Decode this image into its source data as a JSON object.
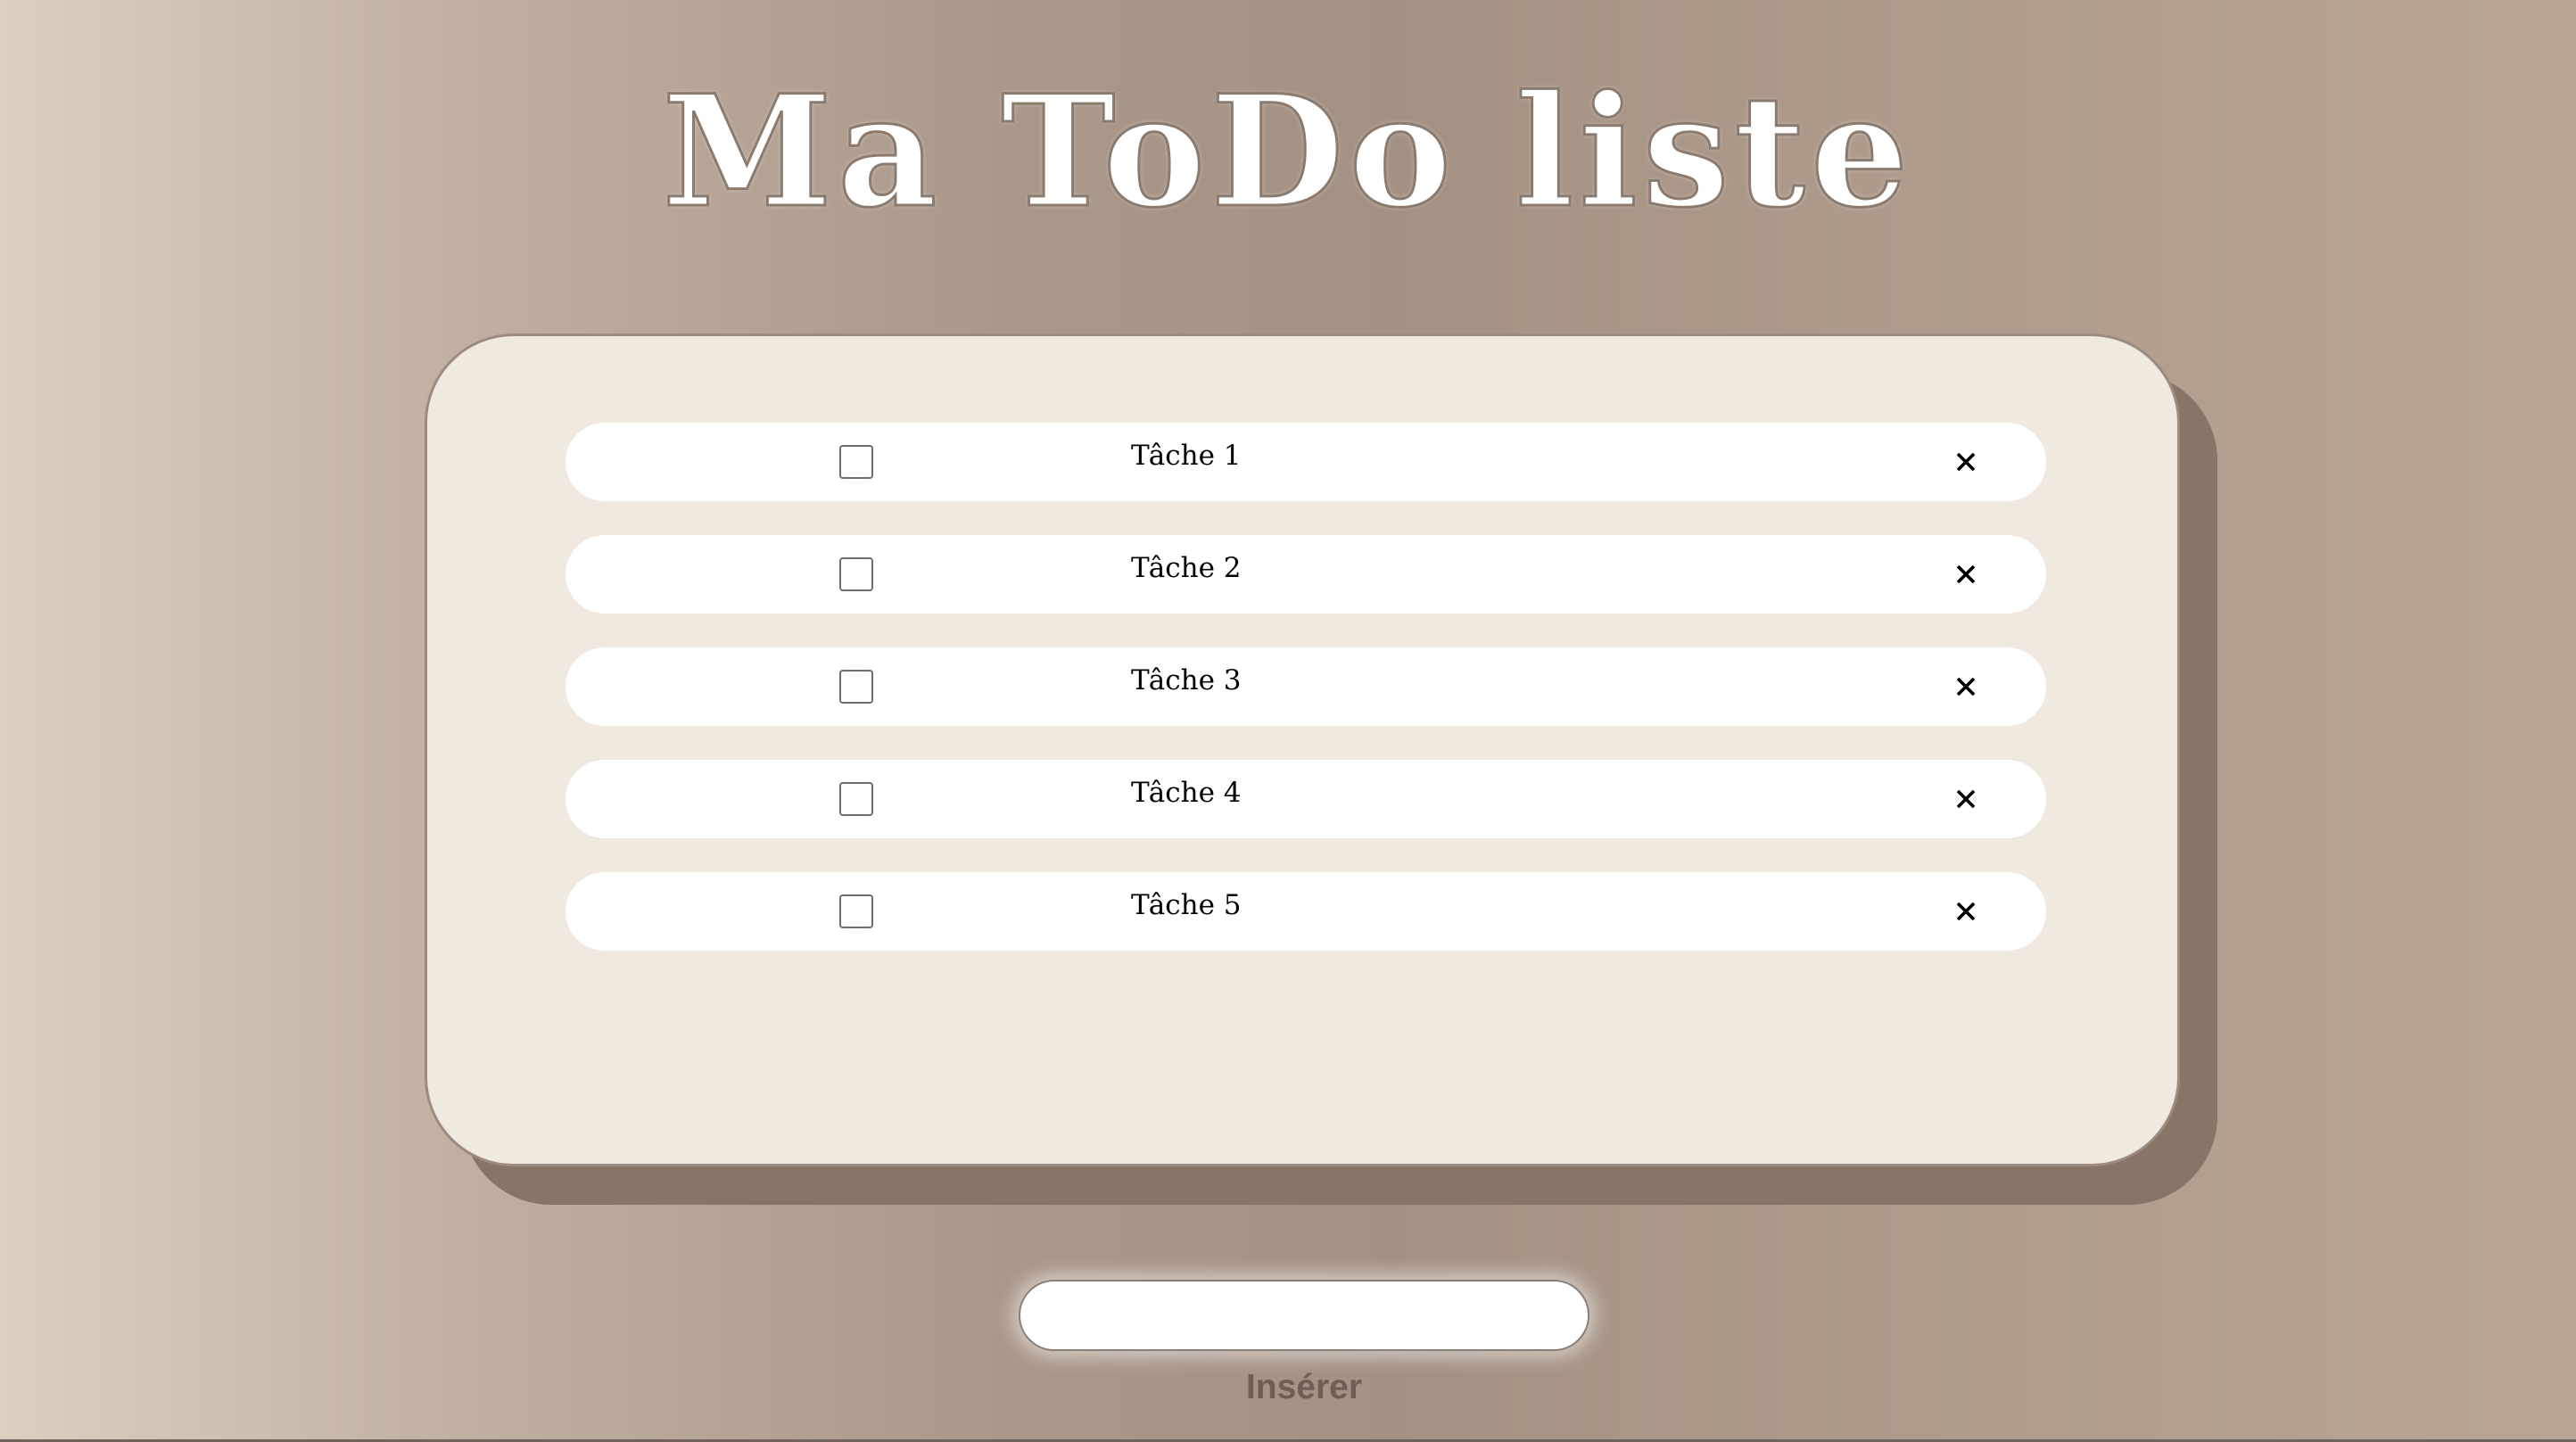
{
  "page": {
    "title": "Ma ToDo liste"
  },
  "tasks": [
    {
      "label": "Tâche 1",
      "checked": false,
      "delete_icon": "close-icon"
    },
    {
      "label": "Tâche 2",
      "checked": false,
      "delete_icon": "close-icon"
    },
    {
      "label": "Tâche 3",
      "checked": false,
      "delete_icon": "close-icon"
    },
    {
      "label": "Tâche 4",
      "checked": false,
      "delete_icon": "close-icon"
    },
    {
      "label": "Tâche 5",
      "checked": false,
      "delete_icon": "close-icon"
    }
  ],
  "form": {
    "input_value": "",
    "input_placeholder": "",
    "insert_label": "Insérer"
  },
  "colors": {
    "background_mid": "#a39183",
    "card": "#f0e9e0",
    "card_shadow": "#877668",
    "row": "#ffffff",
    "title_text": "#ffffff",
    "insert_text": "#6d5f55"
  }
}
